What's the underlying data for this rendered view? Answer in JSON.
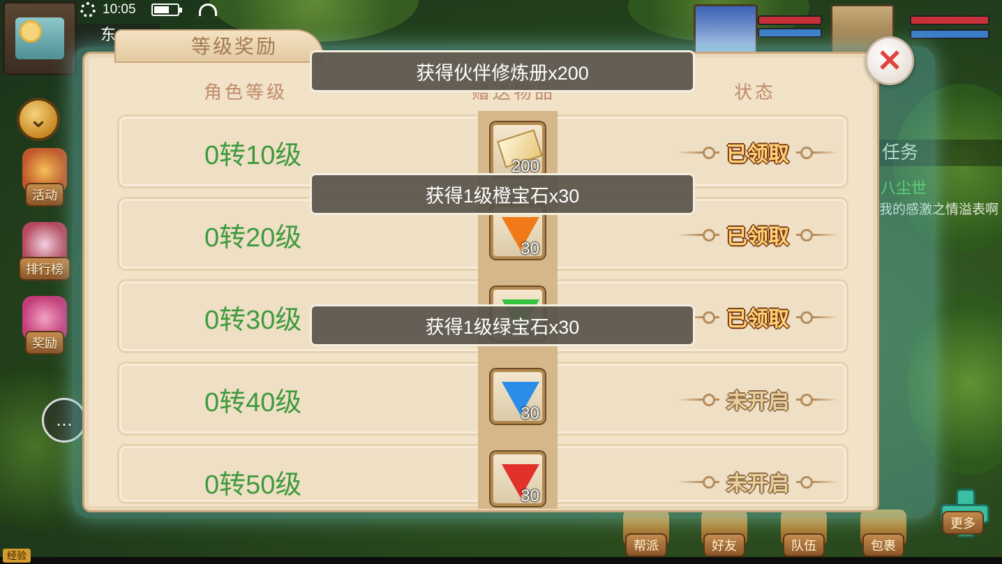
{
  "status_bar": {
    "time": "10:05"
  },
  "hud": {
    "location": "东",
    "side_buttons": [
      {
        "label": "活动",
        "icon": "horn-icon"
      },
      {
        "label": "排行榜",
        "icon": "ranking-bag-icon"
      },
      {
        "label": "奖励",
        "icon": "gift-box-icon"
      }
    ],
    "exp_label": "经验",
    "task": {
      "header": "任务",
      "title": "八尘世",
      "text": "我对我的感激之情溢表啊"
    },
    "nav_buttons": [
      {
        "label": "帮派"
      },
      {
        "label": "好友"
      },
      {
        "label": "队伍"
      },
      {
        "label": "包裹"
      },
      {
        "label": "更多"
      }
    ]
  },
  "dialog": {
    "title": "等级奖励",
    "columns": {
      "level": "角色等级",
      "gift": "赠送物品",
      "status": "状态"
    },
    "rows": [
      {
        "level": "0转10级",
        "item": "partner-training-book",
        "qty": "200",
        "status": "已领取",
        "claimed": true
      },
      {
        "level": "0转20级",
        "item": "orange-gem",
        "qty": "30",
        "status": "已领取",
        "claimed": true
      },
      {
        "level": "0转30级",
        "item": "green-gem",
        "qty": "30",
        "status": "已领取",
        "claimed": true
      },
      {
        "level": "0转40级",
        "item": "blue-gem",
        "qty": "30",
        "status": "未开启",
        "claimed": false
      },
      {
        "level": "0转50级",
        "item": "red-gem",
        "qty": "30",
        "status": "未开启",
        "claimed": false
      }
    ]
  },
  "toasts": [
    "获得伙伴修炼册x200",
    "获得1级橙宝石x30",
    "获得1级绿宝石x30"
  ],
  "colors": {
    "level_text": "#3e9a3e",
    "dialog_bg": "#f2e2c8",
    "close_x": "#e0433e"
  }
}
